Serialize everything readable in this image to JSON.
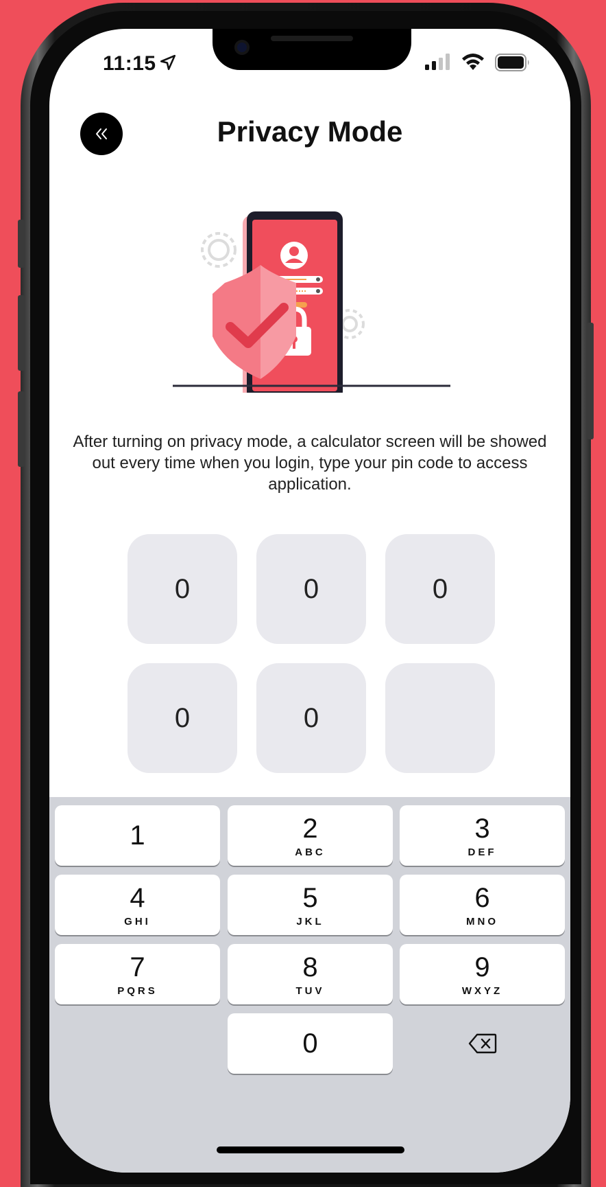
{
  "status_bar": {
    "time": "11:15"
  },
  "header": {
    "title": "Privacy Mode"
  },
  "description": "After turning on privacy mode, a calculator screen will be showed out every time when you login, type your pin code to access application.",
  "pin": {
    "digits": [
      "0",
      "0",
      "0",
      "0",
      "0",
      ""
    ]
  },
  "keyboard": {
    "keys": [
      {
        "num": "1",
        "letters": ""
      },
      {
        "num": "2",
        "letters": "ABC"
      },
      {
        "num": "3",
        "letters": "DEF"
      },
      {
        "num": "4",
        "letters": "GHI"
      },
      {
        "num": "5",
        "letters": "JKL"
      },
      {
        "num": "6",
        "letters": "MNO"
      },
      {
        "num": "7",
        "letters": "PQRS"
      },
      {
        "num": "8",
        "letters": "TUV"
      },
      {
        "num": "9",
        "letters": "WXYZ"
      },
      {
        "num": "0",
        "letters": ""
      }
    ]
  },
  "colors": {
    "background": "#ef4e5a",
    "accent": "#f04e5c",
    "pin_box": "#e9e9ee"
  }
}
